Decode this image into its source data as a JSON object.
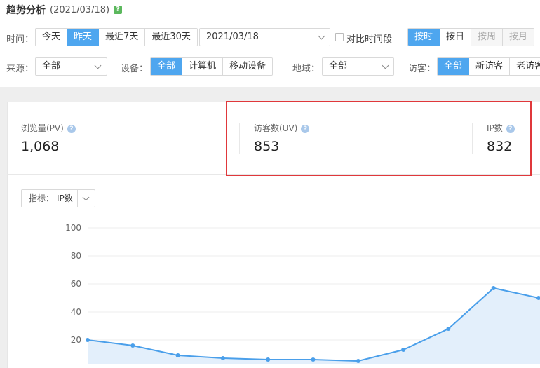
{
  "title": {
    "main": "趋势分析",
    "date": "(2021/03/18)",
    "help": "?"
  },
  "time": {
    "label": "时间：",
    "options": [
      "今天",
      "昨天",
      "最近7天",
      "最近30天"
    ],
    "active": 1,
    "date_value": "2021/03/18",
    "compare_label": "对比时间段"
  },
  "granularity": {
    "options": [
      "按时",
      "按日",
      "按周",
      "按月"
    ],
    "active": 0,
    "disabled": [
      2,
      3
    ]
  },
  "source": {
    "label": "来源：",
    "value": "全部"
  },
  "device": {
    "label": "设备：",
    "options": [
      "全部",
      "计算机",
      "移动设备"
    ],
    "active": 0
  },
  "region": {
    "label": "地域：",
    "value": "全部"
  },
  "visitor": {
    "label": "访客：",
    "options": [
      "全部",
      "新访客",
      "老访客"
    ],
    "active": 0
  },
  "metrics": [
    {
      "label": "浏览量(PV)",
      "value": "1,068"
    },
    {
      "label": "访客数(UV)",
      "value": "853"
    },
    {
      "label": "IP数",
      "value": "832"
    }
  ],
  "indicator": {
    "label": "指标：",
    "value": "IP数"
  },
  "colors": {
    "accent": "#4ea6ef",
    "highlight": "#e0383b",
    "line": "#4a9fea",
    "area": "#e3effb"
  },
  "chart_data": {
    "type": "area",
    "x": [
      0,
      1,
      2,
      3,
      4,
      5,
      6,
      7,
      8,
      9,
      10,
      11,
      12
    ],
    "series": [
      {
        "values": [
          20,
          16,
          9,
          7,
          6,
          6,
          5,
          13,
          28,
          57,
          50,
          null,
          null
        ]
      }
    ],
    "yticks": [
      20,
      40,
      60,
      80,
      100
    ],
    "ylim": [
      0,
      100
    ],
    "grid": true
  }
}
